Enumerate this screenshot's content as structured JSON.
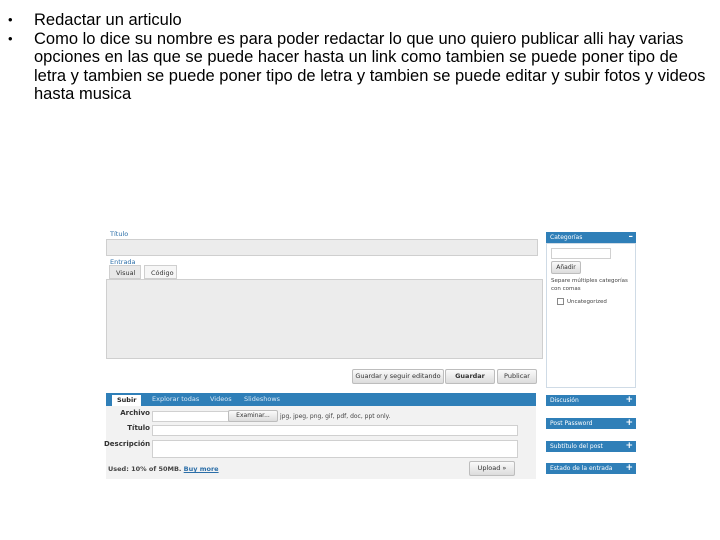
{
  "bullets": [
    "Redactar un articulo",
    "Como lo dice su nombre es para poder redactar lo que uno quiero publicar alli hay varias opciones en las que se puede hacer hasta un link como tambien se puede poner tipo de letra y tambien se puede poner tipo de letra y tambien se puede editar y subir fotos y videos hasta musica"
  ],
  "editor": {
    "title_label": "Título",
    "entry_label": "Entrada",
    "tabs": [
      "Visual",
      "Código"
    ],
    "buttons": {
      "save_continue": "Guardar y seguir editando",
      "save": "Guardar",
      "publish": "Publicar"
    }
  },
  "uploader": {
    "tabs": [
      "Subir",
      "Explorar todas",
      "Videos",
      "Slideshows"
    ],
    "file_label": "Archivo",
    "browse": "Examinar...",
    "formats": "jpg, jpeg, png, gif, pdf, doc, ppt only.",
    "title_label": "Título",
    "description_label": "Descripción",
    "used_text": "Used: 10% of 50MB.",
    "buy_more": "Buy more",
    "upload": "Upload »"
  },
  "sidebar": {
    "categories": {
      "header": "Categorías",
      "collapse": "–",
      "add": "Añadir",
      "hint": "Separe múltiples categorías con comas",
      "uncategorized": "Uncategorized"
    },
    "panels": [
      {
        "header": "Discusión",
        "icon": "+"
      },
      {
        "header": "Post Password",
        "icon": "+"
      },
      {
        "header": "Subtítulo del post",
        "icon": "+"
      },
      {
        "header": "Estado de la entrada",
        "icon": "+"
      }
    ]
  },
  "colors": {
    "accent": "#2f7fb8",
    "link": "#2b6ea8"
  }
}
